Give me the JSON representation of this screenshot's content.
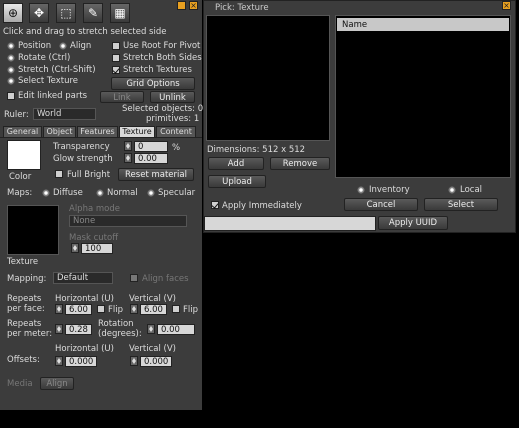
{
  "build": {
    "hint": "Click and drag to stretch selected side",
    "tools": [
      {
        "icon": "magnifier-icon",
        "glyph": "⊕"
      },
      {
        "icon": "hand-icon",
        "glyph": "✥"
      },
      {
        "icon": "cube-select-icon",
        "glyph": "⬚"
      },
      {
        "icon": "wand-icon",
        "glyph": "✎"
      },
      {
        "icon": "land-icon",
        "glyph": "▦"
      }
    ],
    "mode_options": [
      "Position",
      "Align",
      "Rotate (Ctrl)",
      "Stretch (Ctrl-Shift)",
      "Select Texture"
    ],
    "check_options": [
      "Use Root For Pivot",
      "Stretch Both Sides",
      "Stretch Textures"
    ],
    "grid_options": "Grid Options",
    "edit_linked": "Edit linked parts",
    "link": "Link",
    "unlink": "Unlink",
    "selected_objects": "Selected objects: 0",
    "primitives": "primitives: 1",
    "ruler_label": "Ruler:",
    "ruler_value": "World",
    "tabs": [
      "General",
      "Object",
      "Features",
      "Texture",
      "Content"
    ],
    "color_label": "Color",
    "transparency_label": "Transparency",
    "transparency_value": "0",
    "transparency_unit": "%",
    "glow_label": "Glow strength",
    "glow_value": "0.00",
    "full_bright": "Full Bright",
    "reset_material": "Reset material",
    "maps_label": "Maps:",
    "maps_options": [
      "Diffuse",
      "Normal",
      "Specular"
    ],
    "alpha_mode_label": "Alpha mode",
    "alpha_mode_value": "None",
    "mask_cutoff_label": "Mask cutoff",
    "mask_cutoff_value": "100",
    "texture_label": "Texture",
    "mapping_label": "Mapping:",
    "mapping_value": "Default",
    "align_faces": "Align faces",
    "repeats_face_label": "Repeats per face:",
    "horizontal_u": "Horizontal (U)",
    "vertical_v": "Vertical (V)",
    "repeats_face_u": "6.00",
    "repeats_face_v": "6.00",
    "flip": "Flip",
    "repeats_meter_label": "Repeats per meter:",
    "repeats_meter_value": "0.28",
    "rotation_label": "Rotation (degrees):",
    "rotation_value": "0.00",
    "offsets_label": "Offsets:",
    "offset_u": "0.000",
    "offset_v": "0.000",
    "media_label": "Media",
    "align_button": "Align"
  },
  "picker": {
    "title": "Pick: Texture",
    "name_header": "Name",
    "dimensions": "Dimensions: 512 x 512",
    "add": "Add",
    "remove": "Remove",
    "upload": "Upload",
    "inventory": "Inventory",
    "local": "Local",
    "apply_immediately": "Apply Immediately",
    "cancel": "Cancel",
    "select": "Select",
    "apply_uuid": "Apply UUID"
  },
  "colors": {
    "accent": "#e8a020",
    "panel": "#3c3c3c",
    "list_header": "#c8c8c8"
  }
}
